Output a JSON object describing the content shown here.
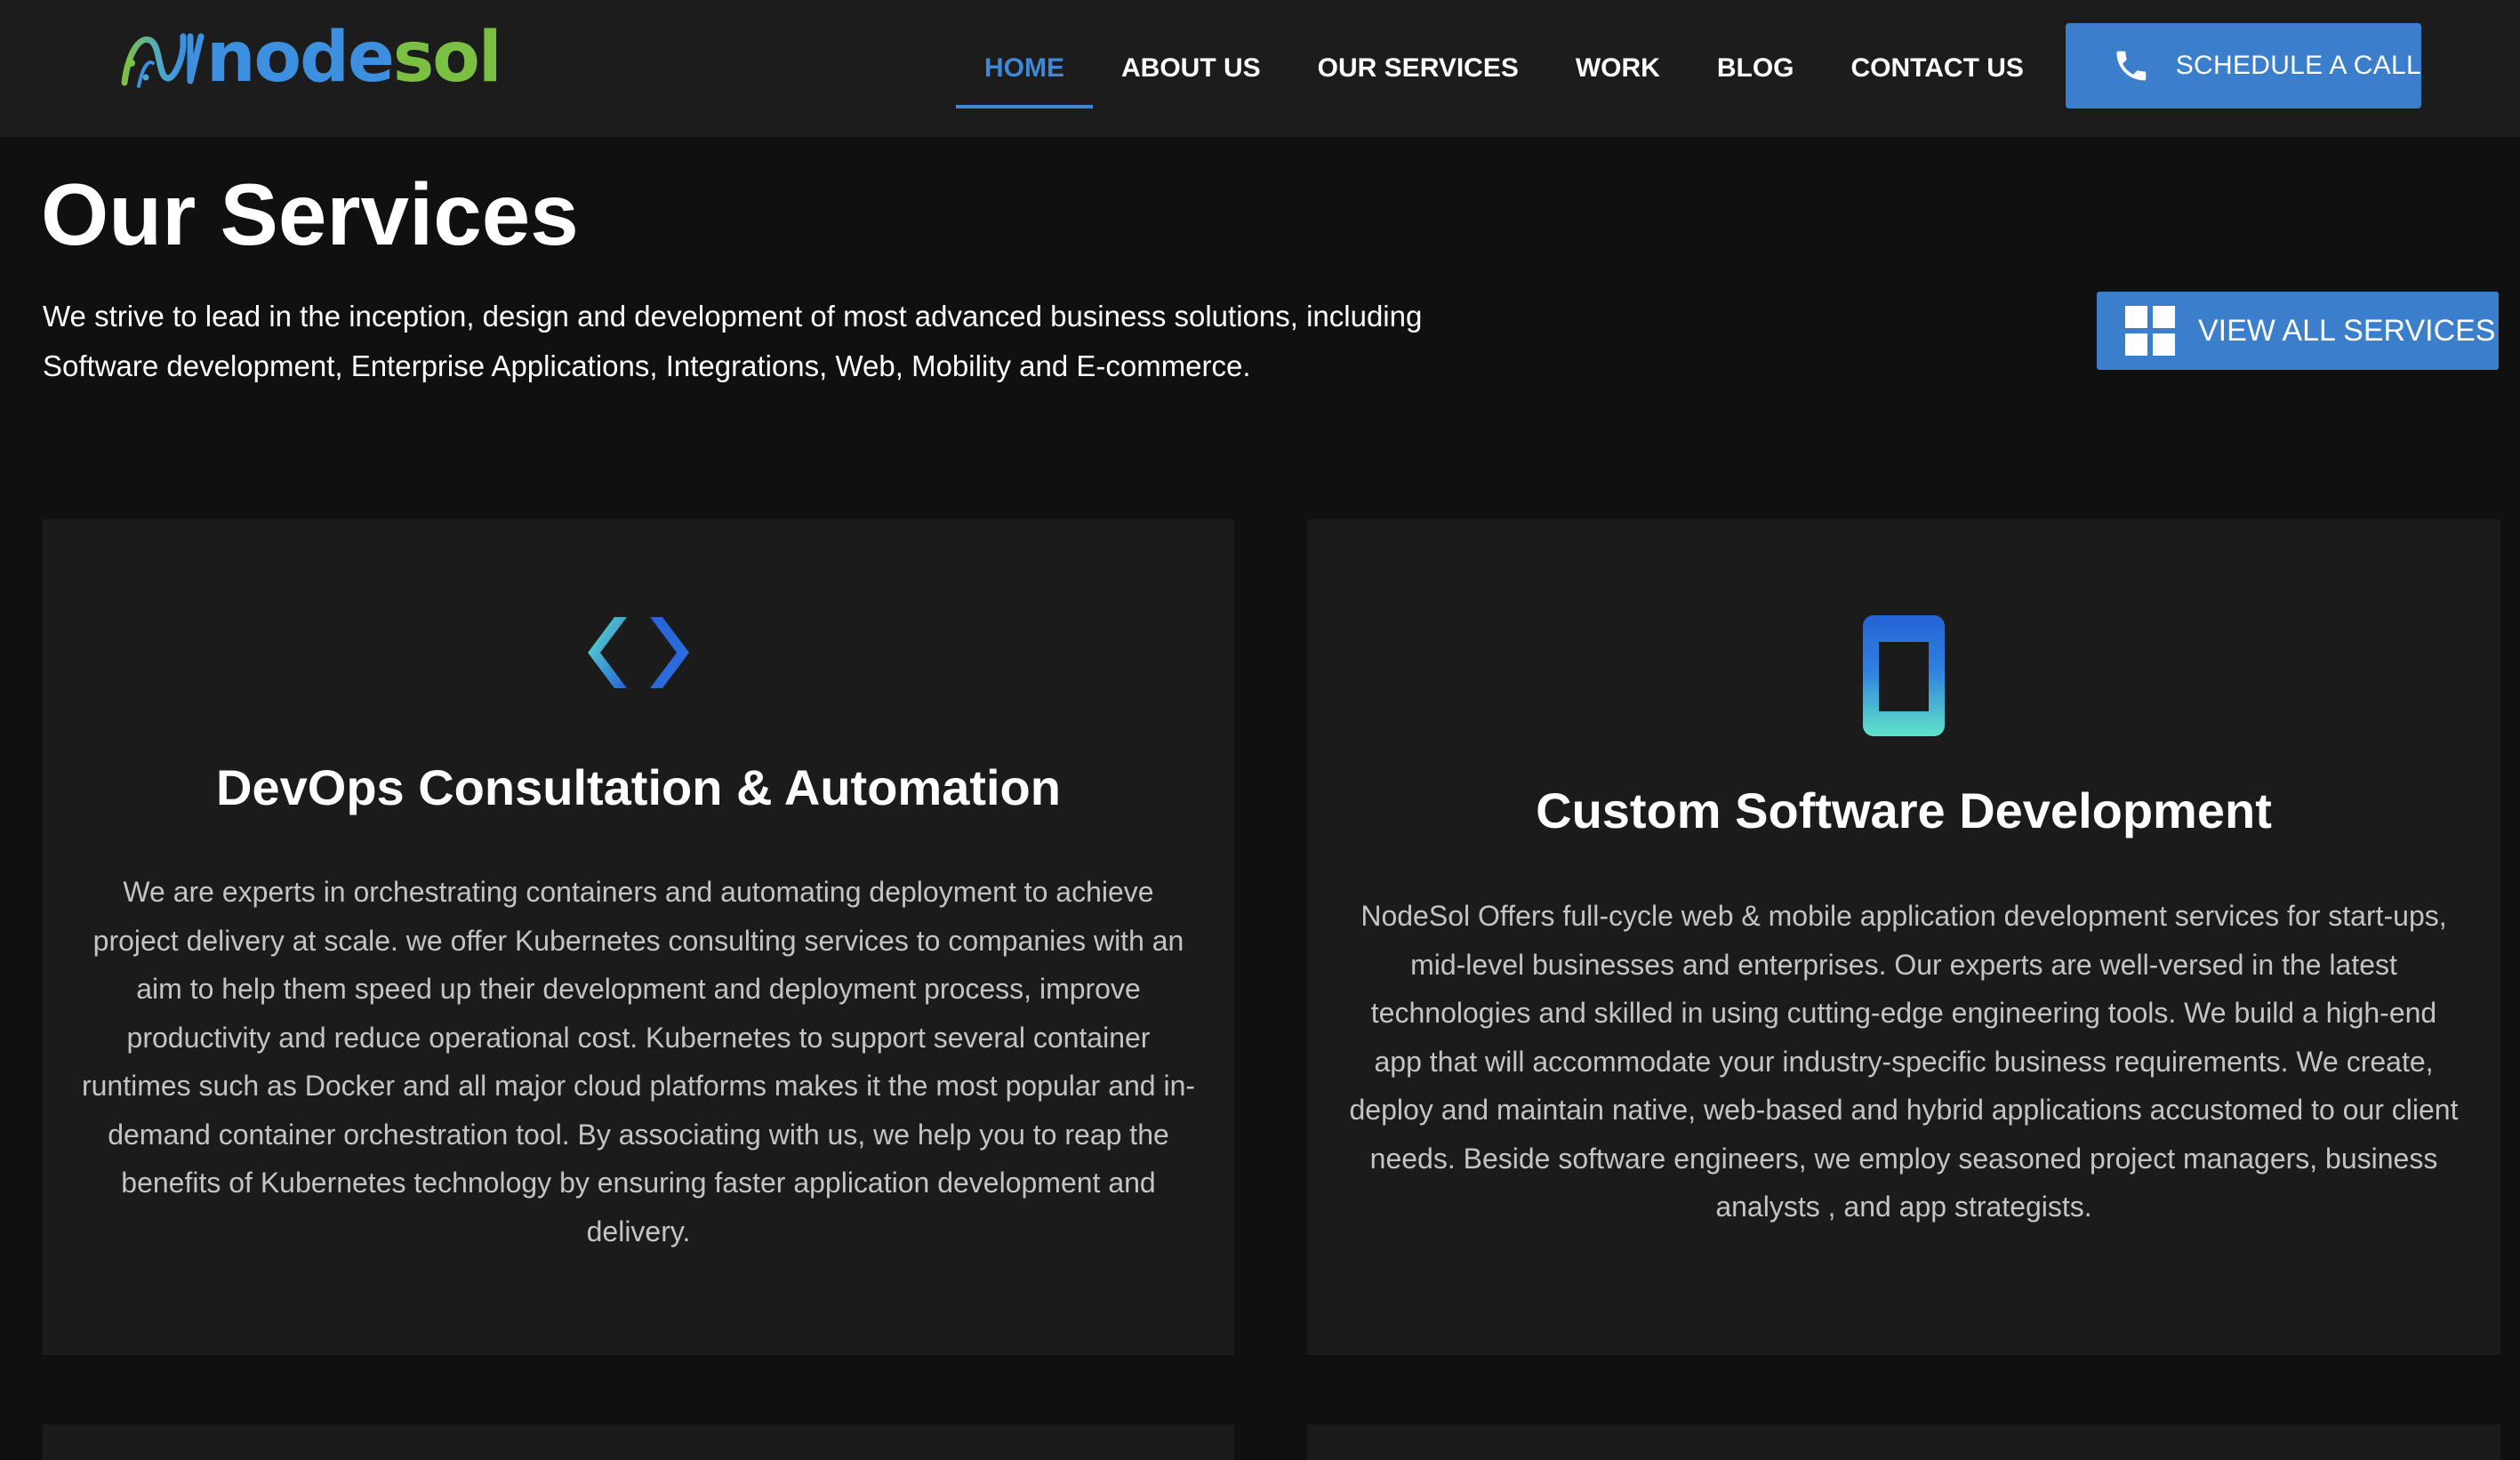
{
  "brand": {
    "name_part1": "node",
    "name_part2": "sol",
    "color_blue": "#3d8fe0",
    "color_green": "#7cc043"
  },
  "nav": {
    "items": [
      {
        "label": "HOME",
        "active": true
      },
      {
        "label": "ABOUT US",
        "active": false
      },
      {
        "label": "OUR SERVICES",
        "active": false
      },
      {
        "label": "WORK",
        "active": false
      },
      {
        "label": "BLOG",
        "active": false
      },
      {
        "label": "CONTACT US",
        "active": false
      }
    ],
    "cta": {
      "label": "SCHEDULE A CALL",
      "icon": "phone-icon"
    },
    "accent_color": "#3f88d6"
  },
  "hero": {
    "title": "Our Services",
    "intro_line1": "We strive to lead in the inception, design and development of most advanced business solutions, including",
    "intro_line2": "Software development, Enterprise Applications, Integrations, Web, Mobility and E-commerce.",
    "view_all": {
      "label": "VIEW ALL SERVICES",
      "icon": "grid-icon"
    }
  },
  "services": [
    {
      "icon": "code-icon",
      "title": "DevOps Consultation & Automation",
      "description_lines": [
        "We are experts in orchestrating containers and automating deployment to achieve",
        "project delivery at scale. we offer Kubernetes consulting services to companies with an",
        "aim to help them speed up their development and deployment process, improve",
        "productivity and reduce operational cost. Kubernetes to support several container",
        "runtimes such as Docker and all major cloud platforms makes it the most popular and in-",
        "demand container orchestration tool. By associating with us, we help you to reap the",
        "benefits of Kubernetes technology by ensuring faster application development and",
        "delivery."
      ]
    },
    {
      "icon": "mobile-phone-icon",
      "title": "Custom Software Development",
      "description_lines": [
        "NodeSol Offers full-cycle web & mobile application development services for start-ups,",
        "mid-level businesses and enterprises. Our experts are well-versed in the latest",
        "technologies and skilled in using cutting-edge engineering tools. We build a high-end",
        "app that will accommodate your industry-specific business requirements. We create,",
        "deploy and maintain native, web-based and hybrid applications accustomed to our client",
        "needs. Beside software engineers, we employ seasoned project managers, business",
        "analysts , and app strategists."
      ]
    }
  ],
  "colors": {
    "page_bg": "#101010",
    "header_bg": "#1c1c1c",
    "card_bg": "#1b1b1b",
    "button_bg": "#3b7fcc",
    "body_text": "#c4c4c4",
    "icon_gradient_start": "#5fe3c8",
    "icon_gradient_end": "#2563d6"
  }
}
